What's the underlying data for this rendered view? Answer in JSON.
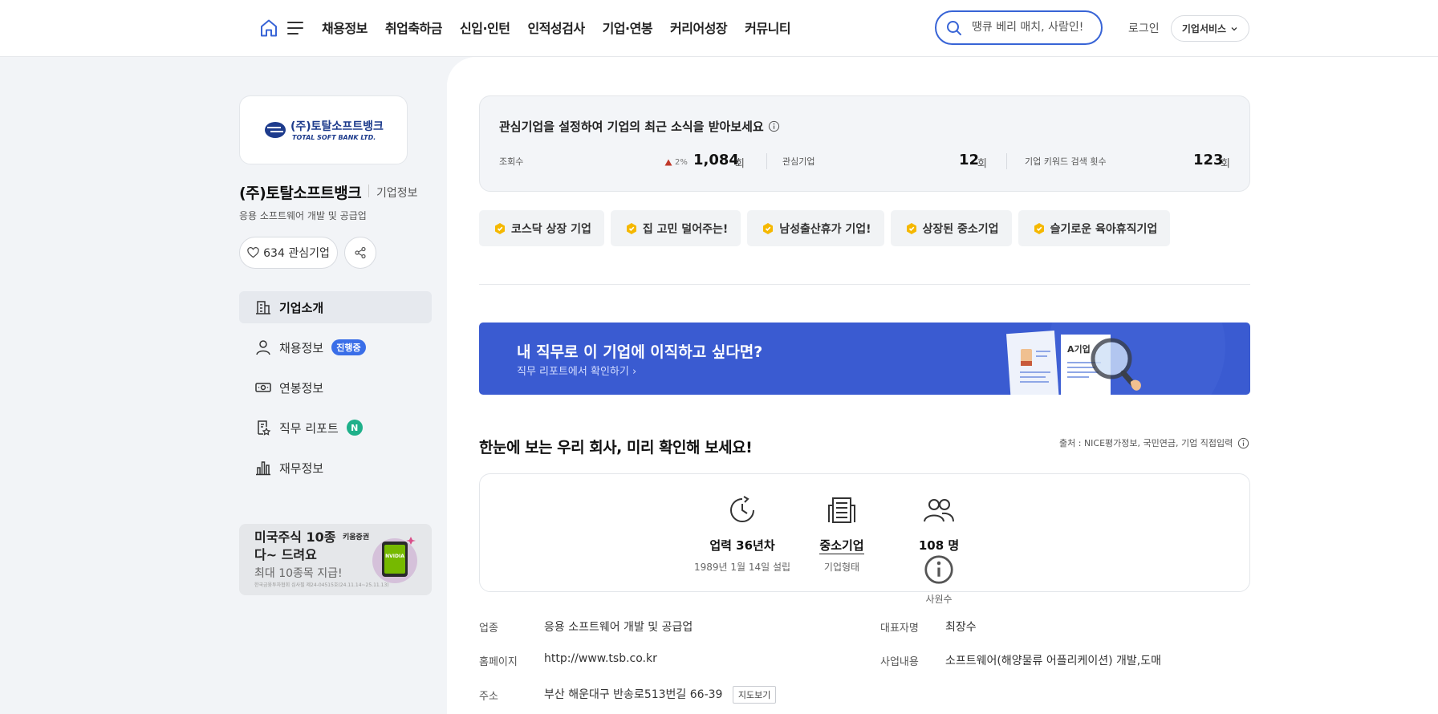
{
  "header": {
    "nav": [
      "채용정보",
      "취업축하금",
      "신입·인턴",
      "인적성검사",
      "기업·연봉",
      "커리어성장",
      "커뮤니티"
    ],
    "search_placeholder": "땡큐 베리 매치, 사람인!",
    "login": "로그인",
    "biz_service": "기업서비스"
  },
  "company": {
    "logo_text": "(주)토탈소프트뱅크",
    "logo_sub": "TOTAL SOFT BANK LTD.",
    "name": "(주)토탈소프트뱅크",
    "info_link": "기업정보",
    "industry": "응용 소프트웨어 개발 및 공급업",
    "fav_label": "634 관심기업"
  },
  "sidebar": {
    "items": [
      {
        "label": "기업소개",
        "icon": "building-icon"
      },
      {
        "label": "채용정보",
        "icon": "person-icon",
        "badge": "진행중"
      },
      {
        "label": "연봉정보",
        "icon": "money-icon"
      },
      {
        "label": "직무 리포트",
        "icon": "report-icon",
        "badge": "N"
      },
      {
        "label": "재무정보",
        "icon": "chart-icon"
      }
    ]
  },
  "ad": {
    "line1": "미국주식 10종",
    "line2": "다~ 드려요",
    "brand": "키움증권",
    "sub": "최대 10종목 지급!",
    "fine": "한국금융투자협회 심사필 제24-04515호(24.11.14~25.11.13)",
    "card_text": "NVIDIA"
  },
  "interest": {
    "title": "관심기업을 설정하여 기업의 최근 소식을 받아보세요",
    "views_label": "조회수",
    "views_trend": "2%",
    "views_value": "1,084",
    "unit": "회",
    "fav_label": "관심기업",
    "fav_value": "12",
    "keyword_label": "기업 키워드 검색 횟수",
    "keyword_value": "123"
  },
  "tags": [
    "코스닥 상장 기업",
    "집 고민 덜어주는!",
    "남성출산휴가 기업!",
    "상장된 중소기업",
    "슬기로운 육아휴직기업"
  ],
  "banner": {
    "title": "내 직무로 이 기업에 이직하고 싶다면?",
    "link": "직무 리포트에서 확인하기",
    "doc_label": "A기업"
  },
  "summary": {
    "title": "한눈에 보는 우리 회사, 미리 확인해 보세요!",
    "source": "출처 : NICE평가정보, 국민연금, 기업 직접입력",
    "history_main": "업력 36년차",
    "history_sub": "1989년 1월 14일 설립",
    "type_main": "중소기업",
    "type_sub": "기업형태",
    "staff_main": "108 명",
    "staff_sub": "사원수"
  },
  "details": {
    "industry_label": "업종",
    "industry_value": "응용 소프트웨어 개발 및 공급업",
    "ceo_label": "대표자명",
    "ceo_value": "최장수",
    "homepage_label": "홈페이지",
    "homepage_value": "http://www.tsb.co.kr",
    "business_label": "사업내용",
    "business_value": "소프트웨어(해양물류 어플리케이션) 개발,도매",
    "address_label": "주소",
    "address_value": "부산 해운대구 반송로513번길 66-39",
    "map_button": "지도보기"
  },
  "colors": {
    "accent": "#3864d6",
    "banner": "#3a5bd1",
    "badge_green": "#1fb08a",
    "trend_red": "#c0392b"
  }
}
